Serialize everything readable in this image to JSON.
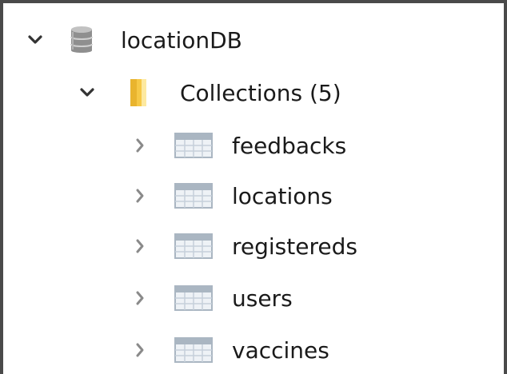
{
  "tree": {
    "database": {
      "label": "locationDB",
      "icon": "database-icon",
      "expanded": true
    },
    "collections_folder": {
      "label": "Collections (5)",
      "icon": "folder-icon",
      "expanded": true
    },
    "collections": [
      {
        "label": "feedbacks",
        "icon": "table-icon",
        "expanded": false
      },
      {
        "label": "locations",
        "icon": "table-icon",
        "expanded": false
      },
      {
        "label": "registereds",
        "icon": "table-icon",
        "expanded": false
      },
      {
        "label": "users",
        "icon": "table-icon",
        "expanded": false
      },
      {
        "label": "vaccines",
        "icon": "table-icon",
        "expanded": false
      }
    ]
  },
  "colors": {
    "frame_border": "#4a4a4a",
    "text": "#1a1a1a",
    "chevron": "#333333",
    "folder": "#f6c846",
    "table_icon": "#aab6c2"
  }
}
